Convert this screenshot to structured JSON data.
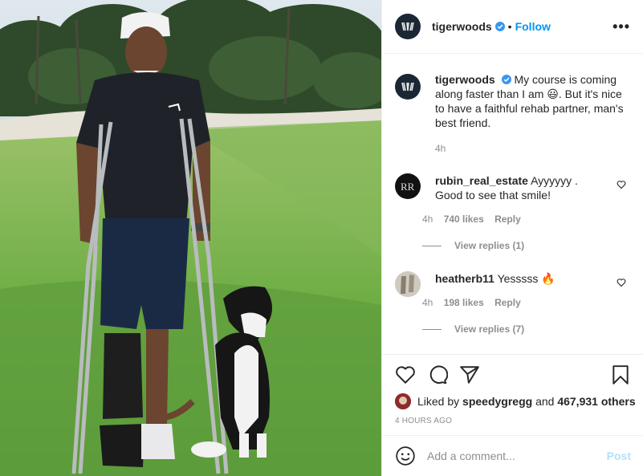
{
  "post": {
    "author": "tigerwoods",
    "follow_label": "Follow",
    "more_label": "•••",
    "separator": "•"
  },
  "caption": {
    "username": "tigerwoods",
    "text": "My course is coming along faster than I am 😃. But it's nice to have a faithful rehab partner, man's best friend.",
    "time": "4h"
  },
  "comments": [
    {
      "username": "rubin_real_estate",
      "text": "Ayyyyyy . Good to see that smile!",
      "time": "4h",
      "likes": "740 likes",
      "reply_label": "Reply",
      "view_replies": "View replies (1)"
    },
    {
      "username": "heatherb11",
      "text": "Yesssss 🔥",
      "time": "4h",
      "likes": "198 likes",
      "reply_label": "Reply",
      "view_replies": "View replies (7)"
    }
  ],
  "likes": {
    "prefix": "Liked by",
    "user": "speedygregg",
    "joiner": "and",
    "count": "467,931 others"
  },
  "posted_ago": "4 HOURS AGO",
  "add_comment": {
    "placeholder": "Add a comment...",
    "post_label": "Post"
  },
  "icons": {
    "verified": "verified-badge-icon",
    "like": "heart-icon",
    "comment": "comment-icon",
    "share": "paper-plane-icon",
    "save": "bookmark-icon",
    "emoji": "smiley-icon"
  },
  "colors": {
    "link": "#0095f6",
    "muted": "#8e8e8e",
    "post_disabled": "#b2dffc",
    "border": "#efefef"
  }
}
